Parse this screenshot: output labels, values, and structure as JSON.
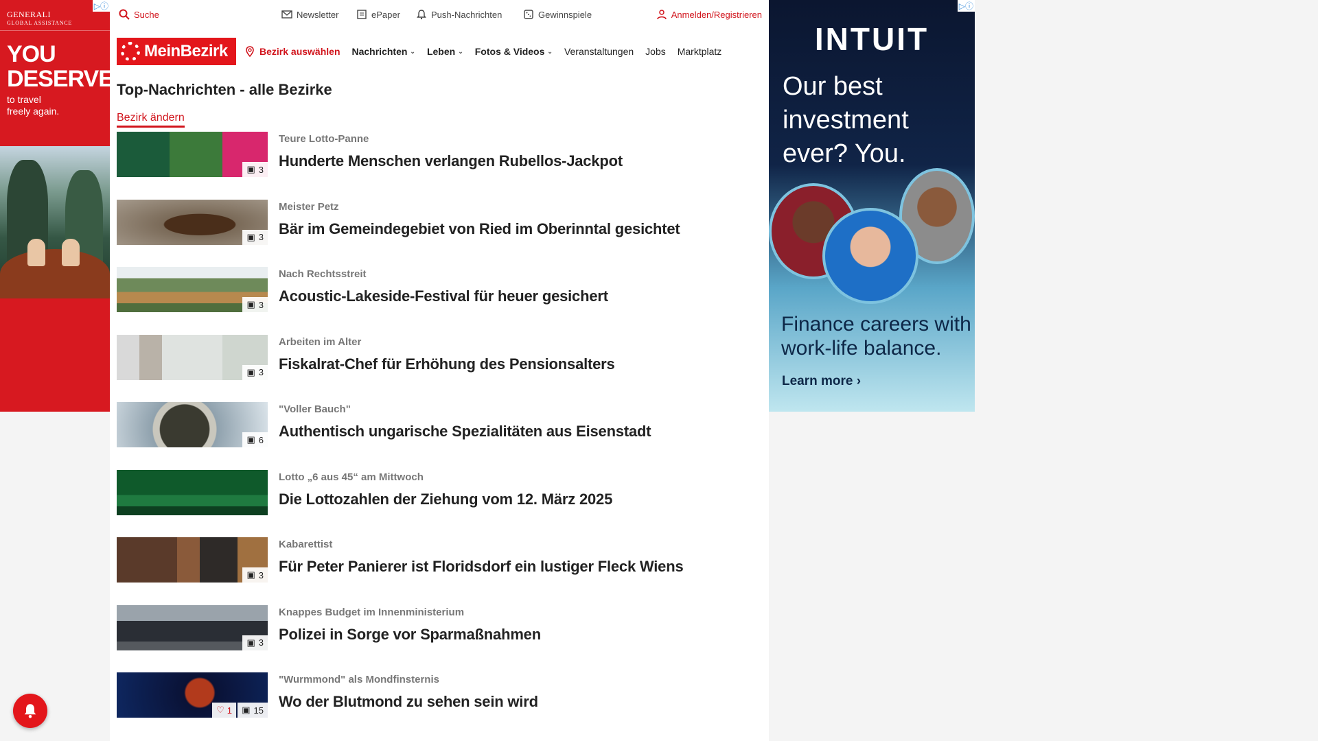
{
  "left_ad": {
    "badge": "▷ⓘ",
    "brand": "GENERALI",
    "brand_sub": "GLOBAL ASSISTANCE",
    "headline_1": "YOU",
    "headline_2": "DESERVE",
    "sub_1": "to travel",
    "sub_2": "freely again."
  },
  "right_ad": {
    "badge": "▷ⓘ",
    "logo": "INTUIT",
    "tagline_1": "Our best",
    "tagline_2": "investment",
    "tagline_3": "ever? You.",
    "copy_1": "Finance careers with",
    "copy_2": "work-life balance.",
    "cta": "Learn more ›"
  },
  "topbar": {
    "search": "Suche",
    "newsletter": "Newsletter",
    "epaper": "ePaper",
    "push": "Push-Nachrichten",
    "games": "Gewinnspiele",
    "login": "Anmelden/Registrieren"
  },
  "nav": {
    "logo": "MeinBezirk",
    "district": "Bezirk auswählen",
    "items": [
      "Nachrichten",
      "Leben",
      "Fotos & Videos",
      "Veranstaltungen",
      "Jobs",
      "Marktplatz"
    ]
  },
  "section": {
    "title": "Top-Nachrichten - alle Bezirke",
    "change": "Bezirk ändern"
  },
  "articles": [
    {
      "kicker": "Teure Lotto-Panne",
      "headline": "Hunderte Menschen verlangen Rubellos-Jackpot",
      "images": "3"
    },
    {
      "kicker": "Meister Petz",
      "headline": "Bär im Gemeindegebiet von Ried im Oberinntal gesichtet",
      "images": "3"
    },
    {
      "kicker": "Nach Rechtsstreit",
      "headline": "Acoustic-Lakeside-Festival für heuer gesichert",
      "images": "3"
    },
    {
      "kicker": "Arbeiten im Alter",
      "headline": "Fiskalrat-Chef für Erhöhung des Pensionsalters",
      "images": "3"
    },
    {
      "kicker": "\"Voller Bauch\"",
      "headline": "Authentisch ungarische Spezialitäten aus Eisenstadt",
      "images": "6"
    },
    {
      "kicker": "Lotto „6 aus 45“ am Mittwoch",
      "headline": "Die Lottozahlen der Ziehung vom 12. März 2025",
      "images": ""
    },
    {
      "kicker": "Kabarettist",
      "headline": "Für Peter Panierer ist Floridsdorf ein lustiger Fleck Wiens",
      "images": "3"
    },
    {
      "kicker": "Knappes Budget im Innenministerium",
      "headline": "Polizei in Sorge vor Sparmaßnahmen",
      "images": "3"
    },
    {
      "kicker": "\"Wurmmond\" als Mondfinsternis",
      "headline": "Wo der Blutmond zu sehen sein wird",
      "images": "15",
      "likes": "1"
    }
  ],
  "colors": {
    "brand_red": "#e3161b",
    "accent_red": "#d1141c"
  }
}
